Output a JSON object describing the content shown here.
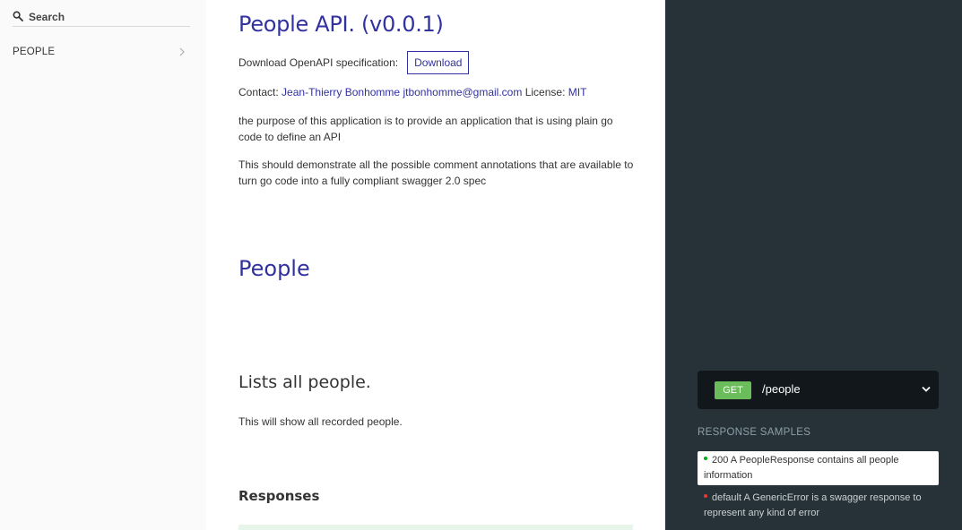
{
  "sidebar": {
    "search_placeholder": "Search",
    "items": [
      {
        "label": "PEOPLE"
      }
    ]
  },
  "main": {
    "title": "People API. (v0.0.1)",
    "download_label": "Download OpenAPI specification:",
    "download_button": "Download",
    "contact_prefix": "Contact:",
    "contact_name": "Jean-Thierry Bonhomme",
    "contact_email": "jtbonhomme@gmail.com",
    "license_prefix": "License:",
    "license_name": "MIT",
    "description_1": "the purpose of this application is to provide an application that is using plain go code to define an API",
    "description_2": "This should demonstrate all the possible comment annotations that are available to turn go code into a fully compliant swagger 2.0 spec",
    "section_title": "People",
    "operation_title": "Lists all people.",
    "operation_description": "This will show all recorded people.",
    "responses_title": "Responses"
  },
  "right_panel": {
    "method": "GET",
    "path": "/people",
    "samples_label": "RESPONSE SAMPLES",
    "samples": [
      {
        "text": "200 A PeopleResponse contains all people information",
        "status_color": "#00aa13"
      },
      {
        "text": "default A GenericError is a swagger response to represent any kind of error",
        "status_color": "#e53935"
      }
    ]
  },
  "colors": {
    "accent": "#32329f",
    "get_badge": "#6bbd5b",
    "right_panel_bg": "#263238",
    "sidebar_bg": "#fafafa"
  }
}
